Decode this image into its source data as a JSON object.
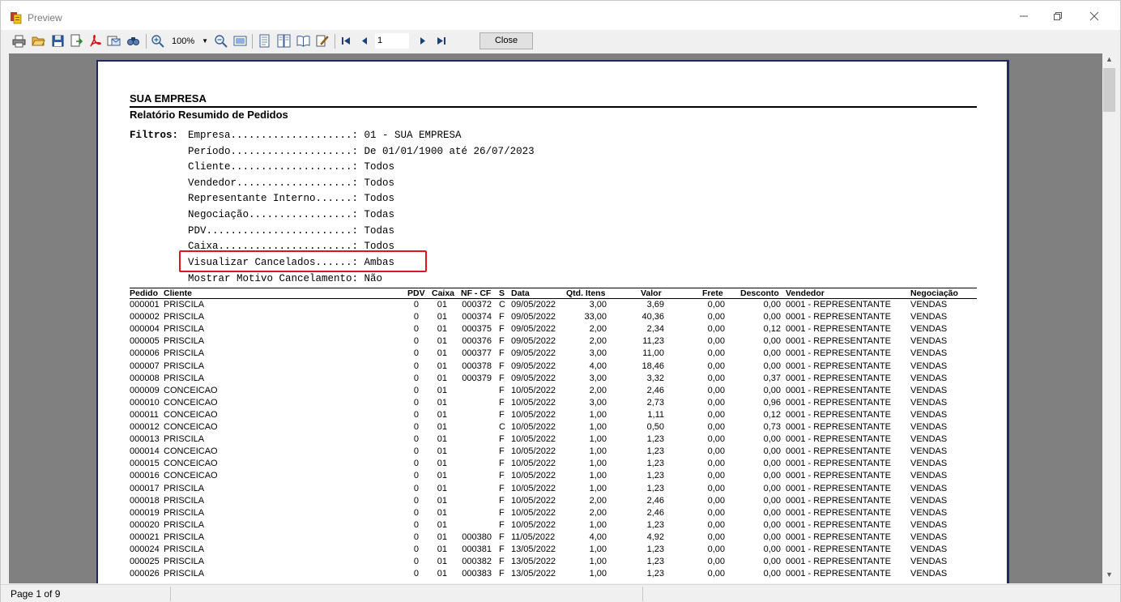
{
  "window": {
    "title": "Preview"
  },
  "toolbar": {
    "zoom": "100%",
    "page": "1",
    "close_label": "Close"
  },
  "status": {
    "page_info": "Page 1 of 9"
  },
  "report": {
    "company": "SUA EMPRESA",
    "title": "Relatório Resumido de Pedidos",
    "filters_label": "Filtros:",
    "filters": [
      "Empresa....................: 01 - SUA EMPRESA",
      "Período....................: De 01/01/1900 até 26/07/2023",
      "Cliente....................: Todos",
      "Vendedor...................: Todos",
      "Representante Interno......: Todos",
      "Negociação.................: Todas",
      "PDV........................: Todas",
      "Caixa......................: Todos",
      "Visualizar Cancelados......: Ambas",
      "Mostrar Motivo Cancelamento: Não"
    ],
    "columns": {
      "pedido": "Pedido",
      "cliente": "Cliente",
      "pdv": "PDV",
      "caixa": "Caixa",
      "nf": "NF - CF",
      "s": "S",
      "data": "Data",
      "qtd": "Qtd. Itens",
      "valor": "Valor",
      "frete": "Frete",
      "desconto": "Desconto",
      "vendedor": "Vendedor",
      "negociacao": "Negociação"
    },
    "rows": [
      {
        "pedido": "000001",
        "cliente": "PRISCILA",
        "pdv": "0",
        "caixa": "01",
        "nf": "000372",
        "s": "C",
        "data": "09/05/2022",
        "qtd": "3,00",
        "valor": "3,69",
        "frete": "0,00",
        "desconto": "0,00",
        "vendedor": "0001 - REPRESENTANTE",
        "negociacao": "VENDAS"
      },
      {
        "pedido": "000002",
        "cliente": "PRISCILA",
        "pdv": "0",
        "caixa": "01",
        "nf": "000374",
        "s": "F",
        "data": "09/05/2022",
        "qtd": "33,00",
        "valor": "40,36",
        "frete": "0,00",
        "desconto": "0,00",
        "vendedor": "0001 - REPRESENTANTE",
        "negociacao": "VENDAS"
      },
      {
        "pedido": "000004",
        "cliente": "PRISCILA",
        "pdv": "0",
        "caixa": "01",
        "nf": "000375",
        "s": "F",
        "data": "09/05/2022",
        "qtd": "2,00",
        "valor": "2,34",
        "frete": "0,00",
        "desconto": "0,12",
        "vendedor": "0001 - REPRESENTANTE",
        "negociacao": "VENDAS"
      },
      {
        "pedido": "000005",
        "cliente": "PRISCILA",
        "pdv": "0",
        "caixa": "01",
        "nf": "000376",
        "s": "F",
        "data": "09/05/2022",
        "qtd": "2,00",
        "valor": "11,23",
        "frete": "0,00",
        "desconto": "0,00",
        "vendedor": "0001 - REPRESENTANTE",
        "negociacao": "VENDAS"
      },
      {
        "pedido": "000006",
        "cliente": "PRISCILA",
        "pdv": "0",
        "caixa": "01",
        "nf": "000377",
        "s": "F",
        "data": "09/05/2022",
        "qtd": "3,00",
        "valor": "11,00",
        "frete": "0,00",
        "desconto": "0,00",
        "vendedor": "0001 - REPRESENTANTE",
        "negociacao": "VENDAS"
      },
      {
        "pedido": "000007",
        "cliente": "PRISCILA",
        "pdv": "0",
        "caixa": "01",
        "nf": "000378",
        "s": "F",
        "data": "09/05/2022",
        "qtd": "4,00",
        "valor": "18,46",
        "frete": "0,00",
        "desconto": "0,00",
        "vendedor": "0001 - REPRESENTANTE",
        "negociacao": "VENDAS"
      },
      {
        "pedido": "000008",
        "cliente": "PRISCILA",
        "pdv": "0",
        "caixa": "01",
        "nf": "000379",
        "s": "F",
        "data": "09/05/2022",
        "qtd": "3,00",
        "valor": "3,32",
        "frete": "0,00",
        "desconto": "0,37",
        "vendedor": "0001 - REPRESENTANTE",
        "negociacao": "VENDAS"
      },
      {
        "pedido": "000009",
        "cliente": "CONCEICAO",
        "pdv": "0",
        "caixa": "01",
        "nf": "",
        "s": "F",
        "data": "10/05/2022",
        "qtd": "2,00",
        "valor": "2,46",
        "frete": "0,00",
        "desconto": "0,00",
        "vendedor": "0001 - REPRESENTANTE",
        "negociacao": "VENDAS"
      },
      {
        "pedido": "000010",
        "cliente": "CONCEICAO",
        "pdv": "0",
        "caixa": "01",
        "nf": "",
        "s": "F",
        "data": "10/05/2022",
        "qtd": "3,00",
        "valor": "2,73",
        "frete": "0,00",
        "desconto": "0,96",
        "vendedor": "0001 - REPRESENTANTE",
        "negociacao": "VENDAS"
      },
      {
        "pedido": "000011",
        "cliente": "CONCEICAO",
        "pdv": "0",
        "caixa": "01",
        "nf": "",
        "s": "F",
        "data": "10/05/2022",
        "qtd": "1,00",
        "valor": "1,11",
        "frete": "0,00",
        "desconto": "0,12",
        "vendedor": "0001 - REPRESENTANTE",
        "negociacao": "VENDAS"
      },
      {
        "pedido": "000012",
        "cliente": "CONCEICAO",
        "pdv": "0",
        "caixa": "01",
        "nf": "",
        "s": "C",
        "data": "10/05/2022",
        "qtd": "1,00",
        "valor": "0,50",
        "frete": "0,00",
        "desconto": "0,73",
        "vendedor": "0001 - REPRESENTANTE",
        "negociacao": "VENDAS"
      },
      {
        "pedido": "000013",
        "cliente": "PRISCILA",
        "pdv": "0",
        "caixa": "01",
        "nf": "",
        "s": "F",
        "data": "10/05/2022",
        "qtd": "1,00",
        "valor": "1,23",
        "frete": "0,00",
        "desconto": "0,00",
        "vendedor": "0001 - REPRESENTANTE",
        "negociacao": "VENDAS"
      },
      {
        "pedido": "000014",
        "cliente": "CONCEICAO",
        "pdv": "0",
        "caixa": "01",
        "nf": "",
        "s": "F",
        "data": "10/05/2022",
        "qtd": "1,00",
        "valor": "1,23",
        "frete": "0,00",
        "desconto": "0,00",
        "vendedor": "0001 - REPRESENTANTE",
        "negociacao": "VENDAS"
      },
      {
        "pedido": "000015",
        "cliente": "CONCEICAO",
        "pdv": "0",
        "caixa": "01",
        "nf": "",
        "s": "F",
        "data": "10/05/2022",
        "qtd": "1,00",
        "valor": "1,23",
        "frete": "0,00",
        "desconto": "0,00",
        "vendedor": "0001 - REPRESENTANTE",
        "negociacao": "VENDAS"
      },
      {
        "pedido": "000016",
        "cliente": "CONCEICAO",
        "pdv": "0",
        "caixa": "01",
        "nf": "",
        "s": "F",
        "data": "10/05/2022",
        "qtd": "1,00",
        "valor": "1,23",
        "frete": "0,00",
        "desconto": "0,00",
        "vendedor": "0001 - REPRESENTANTE",
        "negociacao": "VENDAS"
      },
      {
        "pedido": "000017",
        "cliente": "PRISCILA",
        "pdv": "0",
        "caixa": "01",
        "nf": "",
        "s": "F",
        "data": "10/05/2022",
        "qtd": "1,00",
        "valor": "1,23",
        "frete": "0,00",
        "desconto": "0,00",
        "vendedor": "0001 - REPRESENTANTE",
        "negociacao": "VENDAS"
      },
      {
        "pedido": "000018",
        "cliente": "PRISCILA",
        "pdv": "0",
        "caixa": "01",
        "nf": "",
        "s": "F",
        "data": "10/05/2022",
        "qtd": "2,00",
        "valor": "2,46",
        "frete": "0,00",
        "desconto": "0,00",
        "vendedor": "0001 - REPRESENTANTE",
        "negociacao": "VENDAS"
      },
      {
        "pedido": "000019",
        "cliente": "PRISCILA",
        "pdv": "0",
        "caixa": "01",
        "nf": "",
        "s": "F",
        "data": "10/05/2022",
        "qtd": "2,00",
        "valor": "2,46",
        "frete": "0,00",
        "desconto": "0,00",
        "vendedor": "0001 - REPRESENTANTE",
        "negociacao": "VENDAS"
      },
      {
        "pedido": "000020",
        "cliente": "PRISCILA",
        "pdv": "0",
        "caixa": "01",
        "nf": "",
        "s": "F",
        "data": "10/05/2022",
        "qtd": "1,00",
        "valor": "1,23",
        "frete": "0,00",
        "desconto": "0,00",
        "vendedor": "0001 - REPRESENTANTE",
        "negociacao": "VENDAS"
      },
      {
        "pedido": "000021",
        "cliente": "PRISCILA",
        "pdv": "0",
        "caixa": "01",
        "nf": "000380",
        "s": "F",
        "data": "11/05/2022",
        "qtd": "4,00",
        "valor": "4,92",
        "frete": "0,00",
        "desconto": "0,00",
        "vendedor": "0001 - REPRESENTANTE",
        "negociacao": "VENDAS"
      },
      {
        "pedido": "000024",
        "cliente": "PRISCILA",
        "pdv": "0",
        "caixa": "01",
        "nf": "000381",
        "s": "F",
        "data": "13/05/2022",
        "qtd": "1,00",
        "valor": "1,23",
        "frete": "0,00",
        "desconto": "0,00",
        "vendedor": "0001 - REPRESENTANTE",
        "negociacao": "VENDAS"
      },
      {
        "pedido": "000025",
        "cliente": "PRISCILA",
        "pdv": "0",
        "caixa": "01",
        "nf": "000382",
        "s": "F",
        "data": "13/05/2022",
        "qtd": "1,00",
        "valor": "1,23",
        "frete": "0,00",
        "desconto": "0,00",
        "vendedor": "0001 - REPRESENTANTE",
        "negociacao": "VENDAS"
      },
      {
        "pedido": "000026",
        "cliente": "PRISCILA",
        "pdv": "0",
        "caixa": "01",
        "nf": "000383",
        "s": "F",
        "data": "13/05/2022",
        "qtd": "1,00",
        "valor": "1,23",
        "frete": "0,00",
        "desconto": "0,00",
        "vendedor": "0001 - REPRESENTANTE",
        "negociacao": "VENDAS"
      }
    ]
  }
}
